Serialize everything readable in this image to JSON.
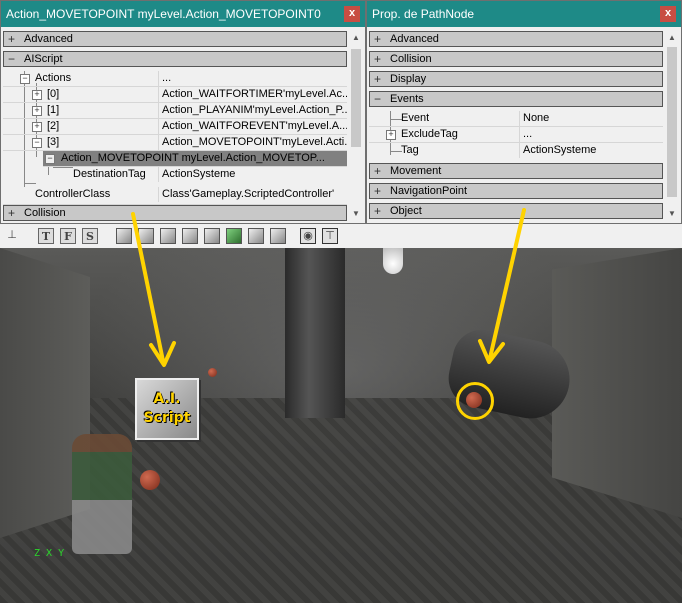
{
  "left_window": {
    "title": "Action_MOVETOPOINT myLevel.Action_MOVETOPOINT0",
    "close_label": "x",
    "categories_top": [
      {
        "label": "Advanced",
        "sign": "+"
      },
      {
        "label": "AIScript",
        "sign": "−"
      }
    ],
    "rows": [
      {
        "name": "Actions",
        "value": "..."
      },
      {
        "name": "[0]",
        "value": "Action_WAITFORTIMER'myLevel.Ac..."
      },
      {
        "name": "[1]",
        "value": "Action_PLAYANIM'myLevel.Action_P..."
      },
      {
        "name": "[2]",
        "value": "Action_WAITFOREVENT'myLevel.A..."
      },
      {
        "name": "[3]",
        "value": "Action_MOVETOPOINT'myLevel.Acti..."
      },
      {
        "name": "Action_MOVETOPOINT myLevel.Action_MOVETOP..."
      },
      {
        "name": "DestinationTag",
        "value": "ActionSysteme"
      },
      {
        "name": "ControllerClass",
        "value": "Class'Gameplay.ScriptedController'"
      }
    ],
    "categories_bottom": [
      {
        "label": "Collision",
        "sign": "+"
      }
    ]
  },
  "right_window": {
    "title": "Prop. de PathNode",
    "close_label": "x",
    "categories_top": [
      {
        "label": "Advanced",
        "sign": "+"
      },
      {
        "label": "Collision",
        "sign": "+"
      },
      {
        "label": "Display",
        "sign": "+"
      },
      {
        "label": "Events",
        "sign": "−"
      }
    ],
    "rows": [
      {
        "name": "Event",
        "value": "None"
      },
      {
        "name": "ExcludeTag",
        "value": "..."
      },
      {
        "name": "Tag",
        "value": "ActionSysteme"
      }
    ],
    "categories_bottom": [
      {
        "label": "Movement",
        "sign": "+"
      },
      {
        "label": "NavigationPoint",
        "sign": "+"
      },
      {
        "label": "Object",
        "sign": "+"
      }
    ]
  },
  "toolbar": {
    "letters": [
      "T",
      "F",
      "S"
    ]
  },
  "viewport": {
    "ai_badge_line1": "A.I.",
    "ai_badge_line2": "Script",
    "axes_label": "Z X Y",
    "annotation_color": "#ffd300"
  }
}
